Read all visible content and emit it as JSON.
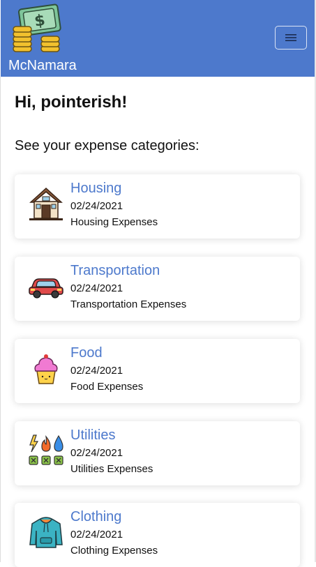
{
  "brand": {
    "name": "McNamara",
    "logo_icon": "money-coins-icon"
  },
  "menu": {
    "icon": "hamburger-menu-icon"
  },
  "greeting": "Hi, pointerish!",
  "subtitle": "See your expense categories:",
  "colors": {
    "navbar": "#4d79cc",
    "link": "#4d79cc"
  },
  "categories": [
    {
      "title": "Housing",
      "date": "02/24/2021",
      "description": "Housing Expenses",
      "icon": "house-icon"
    },
    {
      "title": "Transportation",
      "date": "02/24/2021",
      "description": "Transportation Expenses",
      "icon": "car-icon"
    },
    {
      "title": "Food",
      "date": "02/24/2021",
      "description": "Food Expenses",
      "icon": "cupcake-icon"
    },
    {
      "title": "Utilities",
      "date": "02/24/2021",
      "description": "Utilities Expenses",
      "icon": "utilities-icon"
    },
    {
      "title": "Clothing",
      "date": "02/24/2021",
      "description": "Clothing Expenses",
      "icon": "hoodie-icon"
    }
  ]
}
